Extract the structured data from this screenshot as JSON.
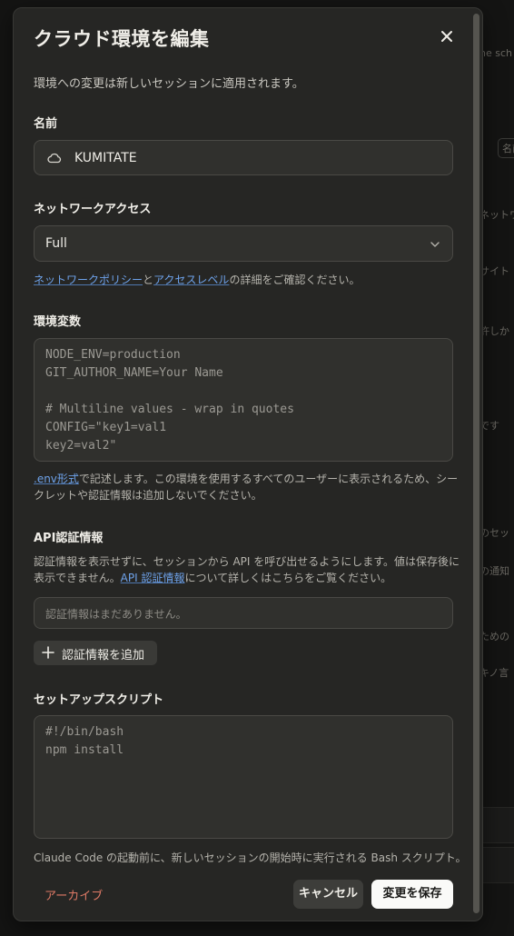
{
  "background": {
    "texts": [
      "ne sch",
      "名前",
      "ネットワ",
      "サイト",
      "許しか",
      "です",
      "のセッ",
      "の通知",
      "ための",
      "キノ言"
    ]
  },
  "modal": {
    "title": "クラウド環境を編集",
    "close_icon": "close-icon",
    "subtitle": "環境への変更は新しいセッションに適用されます。",
    "name": {
      "label": "名前",
      "value": "KUMITATE",
      "icon": "cloud-icon"
    },
    "network": {
      "label": "ネットワークアクセス",
      "selected": "Full",
      "helper_link1": "ネットワークポリシー",
      "helper_mid": "と",
      "helper_link2": "アクセスレベル",
      "helper_tail": "の詳細をご確認ください。"
    },
    "env": {
      "label": "環境変数",
      "placeholder": "NODE_ENV=production\nGIT_AUTHOR_NAME=Your Name\n\n# Multiline values - wrap in quotes\nCONFIG=\"key1=val1\nkey2=val2\"",
      "helper_link": ".env形式",
      "helper_tail": "で記述します。この環境を使用するすべてのユーザーに表示されるため、シークレットや認証情報は追加しないでください。"
    },
    "api": {
      "label": "API認証情報",
      "helper_head": "認証情報を表示せずに、セッションから API を呼び出せるようにします。値は保存後に表示できません。",
      "helper_link": "API 認証情報",
      "helper_tail": "について詳しくはこちらをご覧ください。",
      "empty_text": "認証情報はまだありません。",
      "add_button": "認証情報を追加"
    },
    "setup": {
      "label": "セットアップスクリプト",
      "placeholder": "#!/bin/bash\nnpm install",
      "helper": "Claude Code の起動前に、新しいセッションの開始時に実行される Bash スクリプト。"
    },
    "footer": {
      "archive": "アーカイブ",
      "cancel": "キャンセル",
      "save": "変更を保存"
    }
  },
  "colors": {
    "link": "#6ea2ea",
    "archive": "#e07a66",
    "modal_bg": "#262624"
  }
}
